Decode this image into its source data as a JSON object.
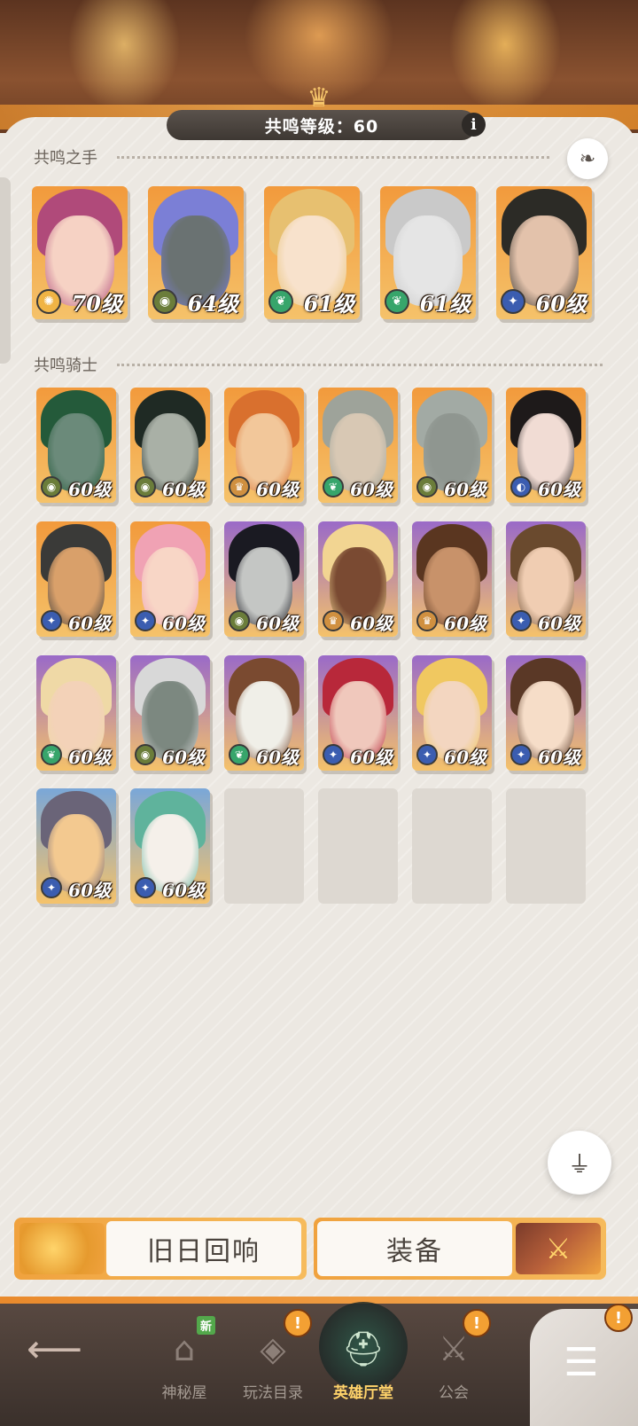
{
  "header": {
    "level_label": "共鸣等级：60",
    "info_label": "i"
  },
  "sections": {
    "hands_title": "共鸣之手",
    "knights_title": "共鸣骑士"
  },
  "hands": [
    {
      "level": "70级",
      "bg": "#f29a3c",
      "hair": "#b04a7a",
      "face": "#f6d2c4",
      "elem": "#f0b445",
      "elem_icon": "✺"
    },
    {
      "level": "64级",
      "bg": "#f29a3c",
      "hair": "#7b7fd6",
      "face": "#6a7272",
      "elem": "#6b7d3a",
      "elem_icon": "◉"
    },
    {
      "level": "61级",
      "bg": "#f29a3c",
      "hair": "#e7c070",
      "face": "#f8e2cc",
      "elem": "#37a56b",
      "elem_icon": "❦"
    },
    {
      "level": "61级",
      "bg": "#f29a3c",
      "hair": "#c9c9c9",
      "face": "#e5e5e5",
      "elem": "#37a56b",
      "elem_icon": "❦"
    },
    {
      "level": "60级",
      "bg": "#f29a3c",
      "hair": "#2c2b26",
      "face": "#e3c2ab",
      "elem": "#3b5db0",
      "elem_icon": "✦"
    }
  ],
  "knights": [
    {
      "level": "60级",
      "bg": "#f29a3c",
      "hair": "#245a3a",
      "face": "#6b8a7a",
      "elem": "#6b7d3a",
      "elem_icon": "◉"
    },
    {
      "level": "60级",
      "bg": "#f29a3c",
      "hair": "#1f2a24",
      "face": "#a9b0a6",
      "elem": "#6b7d3a",
      "elem_icon": "◉"
    },
    {
      "level": "60级",
      "bg": "#f29a3c",
      "hair": "#d9702e",
      "face": "#f2c79a",
      "elem": "#d09040",
      "elem_icon": "♛"
    },
    {
      "level": "60级",
      "bg": "#f29a3c",
      "hair": "#9ea39a",
      "face": "#d8c8b4",
      "elem": "#37a56b",
      "elem_icon": "❦"
    },
    {
      "level": "60级",
      "bg": "#f29a3c",
      "hair": "#a2aaa4",
      "face": "#8f9690",
      "elem": "#6b7d3a",
      "elem_icon": "◉"
    },
    {
      "level": "60级",
      "bg": "#f29a3c",
      "hair": "#1e1a1a",
      "face": "#f1dcd4",
      "elem": "#3b5db0",
      "elem_icon": "◐"
    },
    {
      "level": "60级",
      "bg": "#f29a3c",
      "hair": "#3a3a38",
      "face": "#d9a06a",
      "elem": "#3b5db0",
      "elem_icon": "✦"
    },
    {
      "level": "60级",
      "bg": "#f29a3c",
      "hair": "#f0a2b4",
      "face": "#f8d6c6",
      "elem": "#3b5db0",
      "elem_icon": "✦"
    },
    {
      "level": "60级",
      "bg": "#9a6ac8",
      "hair": "#1a1a22",
      "face": "#c4c6c4",
      "elem": "#6b7d3a",
      "elem_icon": "◉"
    },
    {
      "level": "60级",
      "bg": "#9a6ac8",
      "hair": "#f2d592",
      "face": "#7a4a32",
      "elem": "#d09040",
      "elem_icon": "♛"
    },
    {
      "level": "60级",
      "bg": "#9a6ac8",
      "hair": "#5a3620",
      "face": "#c8926a",
      "elem": "#d09040",
      "elem_icon": "♛"
    },
    {
      "level": "60级",
      "bg": "#9a6ac8",
      "hair": "#6a4a2e",
      "face": "#f0cdb2",
      "elem": "#3b5db0",
      "elem_icon": "✦"
    },
    {
      "level": "60级",
      "bg": "#9a6ac8",
      "hair": "#efd9a6",
      "face": "#f3d2b8",
      "elem": "#37a56b",
      "elem_icon": "❦"
    },
    {
      "level": "60级",
      "bg": "#9a6ac8",
      "hair": "#d8d8d8",
      "face": "#7c8880",
      "elem": "#6b7d3a",
      "elem_icon": "◉"
    },
    {
      "level": "60级",
      "bg": "#9a6ac8",
      "hair": "#7a4a30",
      "face": "#f0efe8",
      "elem": "#37a56b",
      "elem_icon": "❦"
    },
    {
      "level": "60级",
      "bg": "#9a6ac8",
      "hair": "#b8283a",
      "face": "#f0c8bc",
      "elem": "#3b5db0",
      "elem_icon": "✦"
    },
    {
      "level": "60级",
      "bg": "#9a6ac8",
      "hair": "#f0c860",
      "face": "#f3d6c0",
      "elem": "#3b5db0",
      "elem_icon": "✦"
    },
    {
      "level": "60级",
      "bg": "#9a6ac8",
      "hair": "#5a3826",
      "face": "#f6ddc8",
      "elem": "#3b5db0",
      "elem_icon": "✦"
    },
    {
      "level": "60级",
      "bg": "#7aa7d8",
      "hair": "#6a6478",
      "face": "#f3c990",
      "elem": "#3b5db0",
      "elem_icon": "✦"
    },
    {
      "level": "60级",
      "bg": "#7aa7d8",
      "hair": "#5fb39c",
      "face": "#f5f0ea",
      "elem": "#3b5db0",
      "elem_icon": "✦"
    }
  ],
  "actions": {
    "echo_label": "旧日回响",
    "equip_label": "装备"
  },
  "nav": {
    "items": [
      {
        "label": "神秘屋",
        "icon": "⌂"
      },
      {
        "label": "玩法目录",
        "icon": "◈"
      },
      {
        "label": "英雄厅堂",
        "icon": "⛑"
      },
      {
        "label": "公会",
        "icon": "⚔"
      }
    ],
    "new_badge": "新",
    "alert_badge": "!"
  },
  "colors": {
    "accent": "#f0a23e",
    "panel": "#ece8e2",
    "nav_active": "#ffd36a"
  }
}
